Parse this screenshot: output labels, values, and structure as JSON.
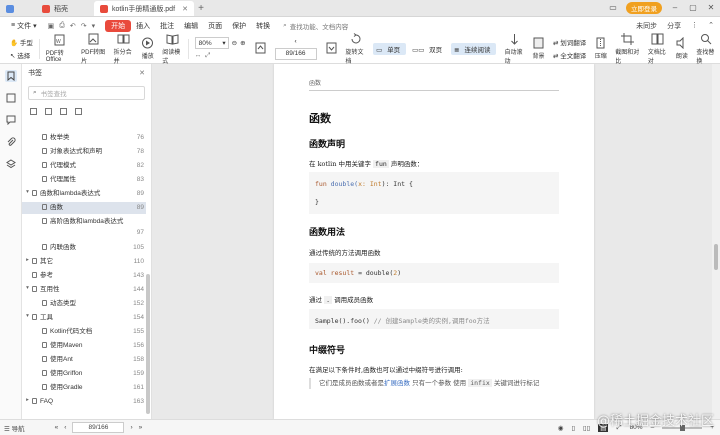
{
  "tabs": {
    "home": "稻壳",
    "doc1": "稻壳",
    "active": "kotlin手册精通版.pdf"
  },
  "titlebar": {
    "login": "立即登录"
  },
  "menu": {
    "file": "文件",
    "items": [
      "开始",
      "插入",
      "批注",
      "编辑",
      "页面",
      "保护",
      "转换"
    ],
    "search": "查找功能、文档内容",
    "right": [
      "未同步",
      "分享"
    ]
  },
  "ribbon": {
    "hand": "手型",
    "select": "选择",
    "pdf_office": "PDF转Office",
    "pdf_image": "PDF转图片",
    "split_merge": "拆分合并",
    "play": "播放",
    "read_mode": "阅读模式",
    "zoom": "80%",
    "page": "89/166",
    "rotate": "旋转文档",
    "single": "单页",
    "double": "双页",
    "continuous": "连续阅读",
    "auto_scroll": "自动滚动",
    "background": "背景",
    "translate_full": "全文翻译",
    "translate_word": "划词翻译",
    "compress": "压缩",
    "screenshot": "截图和对比",
    "compare": "文档比对",
    "read_aloud": "朗读",
    "find_replace": "查找替换"
  },
  "panel": {
    "title": "书签",
    "search_placeholder": "书签查找",
    "items": [
      {
        "label": "枚举类",
        "page": "76",
        "level": 1,
        "arrow": ""
      },
      {
        "label": "对象表达式和声明",
        "page": "78",
        "level": 1,
        "arrow": ""
      },
      {
        "label": "代理模式",
        "page": "82",
        "level": 1,
        "arrow": ""
      },
      {
        "label": "代理属性",
        "page": "83",
        "level": 1,
        "arrow": ""
      },
      {
        "label": "函数和lambda表达式",
        "page": "89",
        "level": 0,
        "arrow": "▾"
      },
      {
        "label": "函数",
        "page": "89",
        "level": 1,
        "arrow": "",
        "selected": true
      },
      {
        "label": "高阶函数和lambda表达式",
        "page": "97",
        "level": 1,
        "arrow": "",
        "wrap": true
      },
      {
        "label": "内联函数",
        "page": "105",
        "level": 1,
        "arrow": ""
      },
      {
        "label": "其它",
        "page": "110",
        "level": 0,
        "arrow": "▸"
      },
      {
        "label": "参考",
        "page": "143",
        "level": 0,
        "arrow": ""
      },
      {
        "label": "互用性",
        "page": "144",
        "level": 0,
        "arrow": "▾"
      },
      {
        "label": "动态类型",
        "page": "152",
        "level": 1,
        "arrow": ""
      },
      {
        "label": "工具",
        "page": "154",
        "level": 0,
        "arrow": "▾"
      },
      {
        "label": "Kotlin代码文档",
        "page": "155",
        "level": 1,
        "arrow": ""
      },
      {
        "label": "使用Maven",
        "page": "156",
        "level": 1,
        "arrow": ""
      },
      {
        "label": "使用Ant",
        "page": "158",
        "level": 1,
        "arrow": ""
      },
      {
        "label": "使用Griffon",
        "page": "159",
        "level": 1,
        "arrow": ""
      },
      {
        "label": "使用Gradle",
        "page": "161",
        "level": 1,
        "arrow": ""
      },
      {
        "label": "FAQ",
        "page": "163",
        "level": 0,
        "arrow": "▸"
      }
    ]
  },
  "doc": {
    "header": "函数",
    "h1": "函数",
    "h2_decl": "函数声明",
    "p_decl_pre": "在 kotlin 中用关键字",
    "p_decl_kw": "fun",
    "p_decl_post": "声明函数：",
    "code1_l1_kw": "fun",
    "code1_l1_fn": "double(",
    "code1_l1_pm": "x: Int",
    "code1_l1_rest": "): Int {",
    "code1_l2": "}",
    "h2_usage": "函数用法",
    "p_usage": "通过传统的方法调用函数",
    "code2_kw": "val",
    "code2_name": "result",
    "code2_rest_a": " = double(",
    "code2_num": "2",
    "code2_rest_b": ")",
    "p_member_pre": "通过",
    "p_member_kw": ".",
    "p_member_post": "调用成员函数",
    "code3_a": "Sample().foo()",
    "code3_cm": "// 创建Sample类的实例,调用foo方法",
    "h2_infix": "中缀符号",
    "p_infix": "在满足以下条件时,函数也可以通过中缀符号进行调用:",
    "quote_a": "它们是成员函数或者是",
    "quote_link": "扩展函数",
    "quote_b": "只有一个参数 使用",
    "quote_kw": "infix",
    "quote_c": "关键词进行标记"
  },
  "status": {
    "nav": "导航",
    "page": "89/166",
    "zoom": "80%"
  },
  "watermark": "@稀土掘金技术社区"
}
